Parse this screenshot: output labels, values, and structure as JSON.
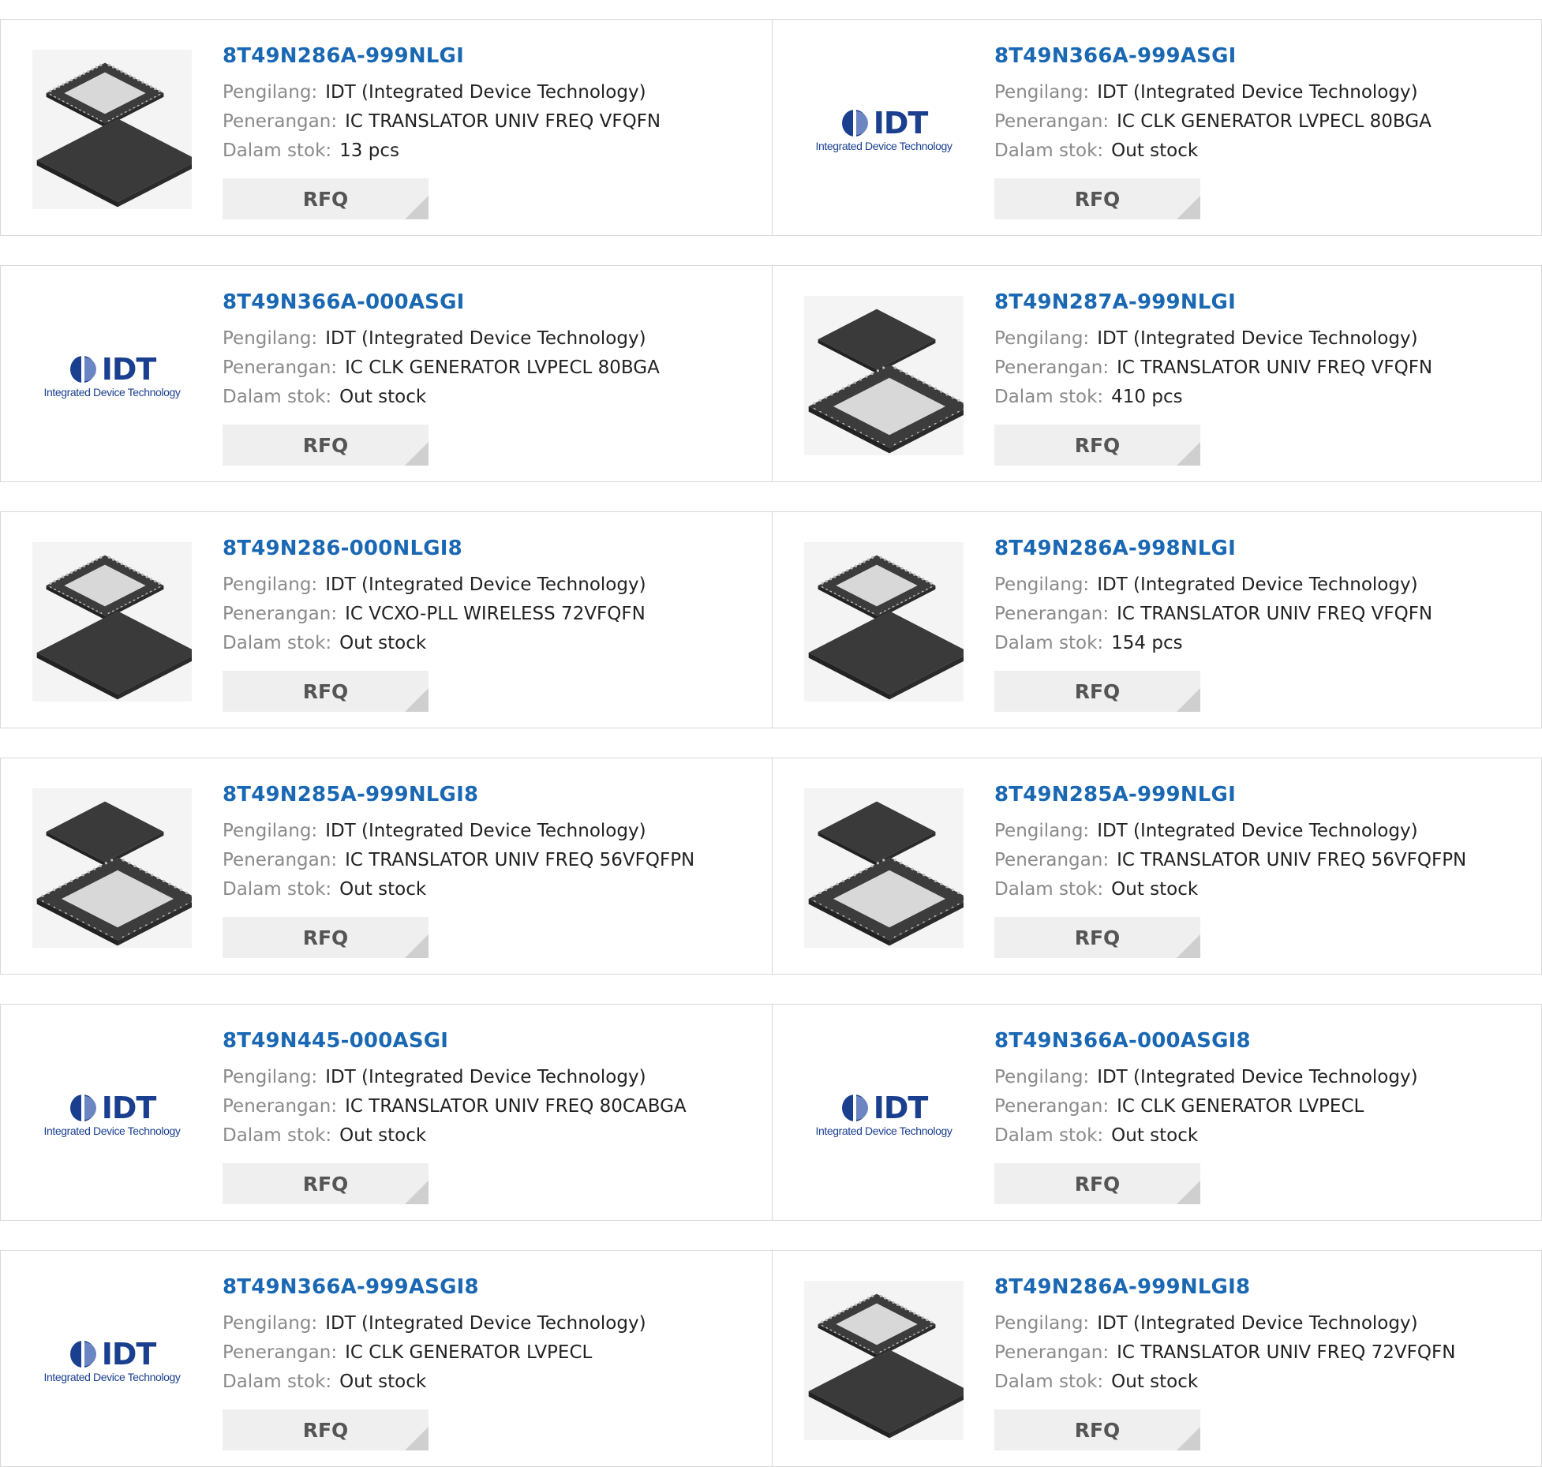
{
  "labels": {
    "manufacturer": "Pengilang:",
    "description": "Penerangan:",
    "stock": "Dalam stok:",
    "rfq": "RFQ"
  },
  "logo": {
    "word": "IDT",
    "sub": "Integrated Device Technology"
  },
  "colors": {
    "part_link": "#1a68b3",
    "label": "#8a8a8a",
    "rfq_bg": "#efefef",
    "logo": "#1a3f8f"
  },
  "products": [
    {
      "part": "8T49N286A-999NLGI",
      "manufacturer": "IDT (Integrated Device Technology)",
      "description": "IC TRANSLATOR UNIV FREQ VFQFN",
      "stock": "13 pcs",
      "image": "chip-stack-top-light"
    },
    {
      "part": "8T49N366A-999ASGI",
      "manufacturer": "IDT (Integrated Device Technology)",
      "description": "IC CLK GENERATOR LVPECL 80BGA",
      "stock": "Out stock",
      "image": "idt-logo"
    },
    {
      "part": "8T49N366A-000ASGI",
      "manufacturer": "IDT (Integrated Device Technology)",
      "description": "IC CLK GENERATOR LVPECL 80BGA",
      "stock": "Out stock",
      "image": "idt-logo"
    },
    {
      "part": "8T49N287A-999NLGI",
      "manufacturer": "IDT (Integrated Device Technology)",
      "description": "IC TRANSLATOR UNIV FREQ VFQFN",
      "stock": "410 pcs",
      "image": "chip-stack-top-dark"
    },
    {
      "part": "8T49N286-000NLGI8",
      "manufacturer": "IDT (Integrated Device Technology)",
      "description": "IC VCXO-PLL WIRELESS 72VFQFN",
      "stock": "Out stock",
      "image": "chip-stack-top-light"
    },
    {
      "part": "8T49N286A-998NLGI",
      "manufacturer": "IDT (Integrated Device Technology)",
      "description": "IC TRANSLATOR UNIV FREQ VFQFN",
      "stock": "154 pcs",
      "image": "chip-stack-top-light"
    },
    {
      "part": "8T49N285A-999NLGI8",
      "manufacturer": "IDT (Integrated Device Technology)",
      "description": "IC TRANSLATOR UNIV FREQ 56VFQFPN",
      "stock": "Out stock",
      "image": "chip-stack-top-dark"
    },
    {
      "part": "8T49N285A-999NLGI",
      "manufacturer": "IDT (Integrated Device Technology)",
      "description": "IC TRANSLATOR UNIV FREQ 56VFQFPN",
      "stock": "Out stock",
      "image": "chip-stack-top-dark"
    },
    {
      "part": "8T49N445-000ASGI",
      "manufacturer": "IDT (Integrated Device Technology)",
      "description": "IC TRANSLATOR UNIV FREQ 80CABGA",
      "stock": "Out stock",
      "image": "idt-logo"
    },
    {
      "part": "8T49N366A-000ASGI8",
      "manufacturer": "IDT (Integrated Device Technology)",
      "description": "IC CLK GENERATOR LVPECL",
      "stock": "Out stock",
      "image": "idt-logo"
    },
    {
      "part": "8T49N366A-999ASGI8",
      "manufacturer": "IDT (Integrated Device Technology)",
      "description": "IC CLK GENERATOR LVPECL",
      "stock": "Out stock",
      "image": "idt-logo"
    },
    {
      "part": "8T49N286A-999NLGI8",
      "manufacturer": "IDT (Integrated Device Technology)",
      "description": "IC TRANSLATOR UNIV FREQ 72VFQFN",
      "stock": "Out stock",
      "image": "chip-stack-top-light"
    }
  ]
}
